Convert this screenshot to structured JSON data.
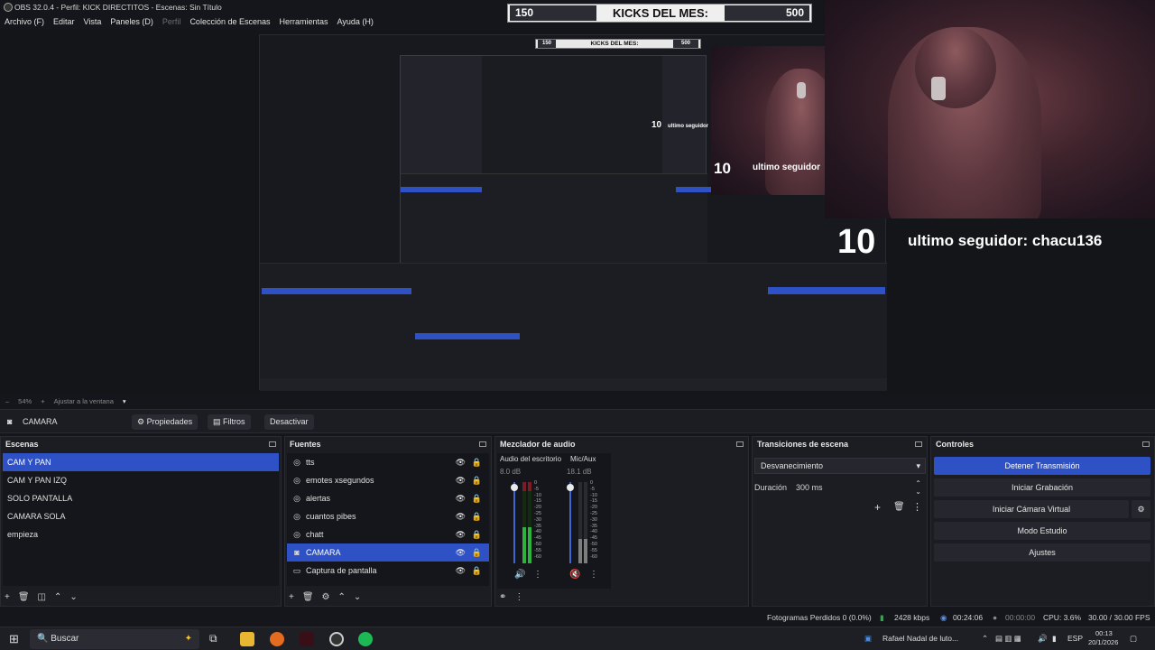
{
  "window": {
    "title": "OBS 32.0.4 - Perfil: KICK DIRECTITOS - Escenas: Sin Título"
  },
  "menu": [
    "Archivo (F)",
    "Editar",
    "Vista",
    "Paneles (D)",
    "Perfil",
    "Colección de Escenas",
    "Herramientas",
    "Ayuda (H)"
  ],
  "overlay": {
    "kicks_left": "150",
    "kicks_label": "KICKS DEL MES:",
    "kicks_right": "500",
    "follower_count": "10",
    "follower_label": "ultimo seguidor: chacu136",
    "mini_follower_label": "ultimo seguidor"
  },
  "zoom": {
    "minus": "–",
    "percent": "54%",
    "plus": "+",
    "fit": "Ajustar a la ventana"
  },
  "source_toolbar": {
    "source": "CAMARA",
    "properties": "Propiedades",
    "filters": "Filtros",
    "deactivate": "Desactivar"
  },
  "scenes": {
    "title": "Escenas",
    "items": [
      "CAM Y PAN",
      "CAM Y PAN IZQ",
      "SOLO PANTALLA",
      "CAMARA SOLA",
      "empieza"
    ]
  },
  "sources": {
    "title": "Fuentes",
    "items": [
      "tts",
      "emotes xsegundos",
      "alertas",
      "cuantos pibes",
      "chatt",
      "CAMARA",
      "Captura de pantalla"
    ]
  },
  "mixer": {
    "title": "Mezclador de audio",
    "ch1_name": "Audio del escritorio",
    "ch1_db": "8.0 dB",
    "ch2_name": "Mic/Aux",
    "ch2_db": "18.1 dB",
    "scale": [
      "0",
      "-5",
      "-10",
      "-15",
      "-20",
      "-25",
      "-30",
      "-35",
      "-40",
      "-45",
      "-50",
      "-55",
      "-60"
    ],
    "ch1_level": 0.45,
    "ch2_level": 0.3
  },
  "transitions": {
    "title": "Transiciones de escena",
    "selected": "Desvanecimiento",
    "duration_label": "Duración",
    "duration_value": "300 ms"
  },
  "controls": {
    "title": "Controles",
    "stop_stream": "Detener Transmisión",
    "start_recording": "Iniciar Grabación",
    "start_vcam": "Iniciar Cámara Virtual",
    "studio_mode": "Modo Estudio",
    "settings": "Ajustes"
  },
  "status": {
    "dropped": "Fotogramas Perdidos 0 (0.0%)",
    "bitrate": "2428 kbps",
    "stream_time": "00:24:06",
    "rec_time": "00:00:00",
    "cpu": "CPU: 3.6%",
    "fps": "30.00 / 30.00 FPS"
  },
  "taskbar": {
    "search": "Buscar",
    "active_window": "Rafael Nadal de luto...",
    "lang": "ESP",
    "time": "00:13",
    "date": "20/1/2026"
  },
  "colors": {
    "accent": "#2e52c5",
    "meter_green": "#2fb23b",
    "meter_red": "#7b1b26"
  }
}
